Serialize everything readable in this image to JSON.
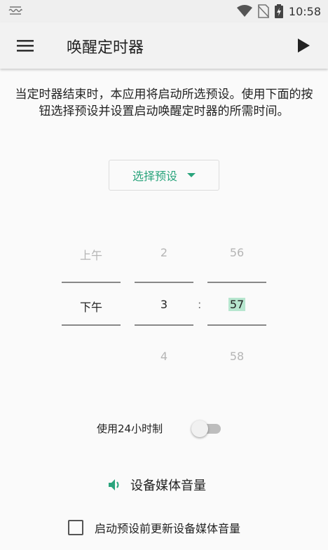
{
  "status_bar": {
    "time": "10:58",
    "icons": [
      "signal-wave-icon",
      "wifi-icon",
      "no-sim-icon",
      "battery-charging-icon"
    ]
  },
  "app_bar": {
    "menu_icon": "hamburger-menu-icon",
    "title": "唤醒定时器",
    "action_icon": "play-icon"
  },
  "description": "当定时器结束时，本应用将启动所选预设。使用下面的按钮选择预设并设置启动唤醒定时器的所需时间。",
  "preset_button": {
    "label": "选择预设"
  },
  "time_picker": {
    "ampm": {
      "prev": "上午",
      "current": "下午"
    },
    "hour": {
      "prev": "2",
      "current": "3",
      "next": "4"
    },
    "separator": ":",
    "minute": {
      "prev": "56",
      "current": "57",
      "next": "58"
    }
  },
  "use_24h": {
    "label": "使用24小时制",
    "enabled": false
  },
  "volume_button": {
    "label": "设备媒体音量",
    "icon": "speaker-volume-icon"
  },
  "update_volume_checkbox": {
    "label": "启动预设前更新设备媒体音量",
    "checked": false
  },
  "colors": {
    "accent": "#2aa47c",
    "highlight": "#b7e6cf"
  }
}
